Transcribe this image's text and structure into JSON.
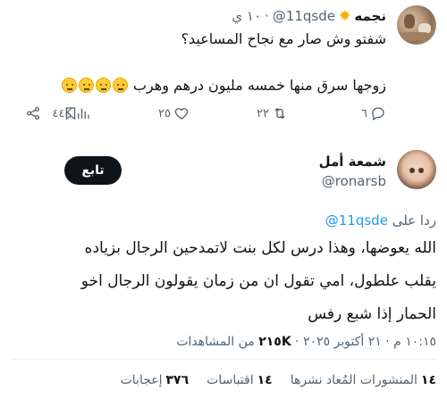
{
  "parent_tweet": {
    "author_name": "نجمه",
    "handle": "@11qsde",
    "dot": "·",
    "time": "١٠ ي",
    "line1": "شفتو وش صار مع نجاح المساعيد؟",
    "line2": "زوجها سرق منها خمسه مليون درهم وهرب",
    "emoji_count": 4,
    "reply_count": "٦",
    "retweet_count": "٢٢",
    "like_count": "٢٥",
    "view_count": "٤٤K"
  },
  "reply_tweet": {
    "author_name": "شمعة أمل",
    "handle": "@ronarsb",
    "follow_label": "تابع",
    "reply_to_label": "ردا على",
    "reply_to_handle": "@11qsde",
    "body_line1": "الله يعوضها، وهذا درس لكل بنت لاتمدحين الرجال بزياده",
    "body_line2": "يقلب علطول، امي تقول ان من زمان يقولون الرجال اخو",
    "body_line3": "الحمار إذا شبع رفس",
    "meta_time": "١٠:١٥ م · ٢١ أكتوبر ٢٠٢٥ · ",
    "meta_views_count": "٢١٥K",
    "meta_views_label": "من المشاهدات",
    "stats": [
      {
        "count": "١٤",
        "label": "المنشورات المُعاد نشرها"
      },
      {
        "count": "١٤",
        "label": "اقتباسات"
      },
      {
        "count": "٣٧٦",
        "label": "إعجابات"
      }
    ]
  },
  "colors": {
    "accent": "#1d9bf0",
    "secondary_text": "#536471",
    "primary_text": "#0f1419"
  }
}
